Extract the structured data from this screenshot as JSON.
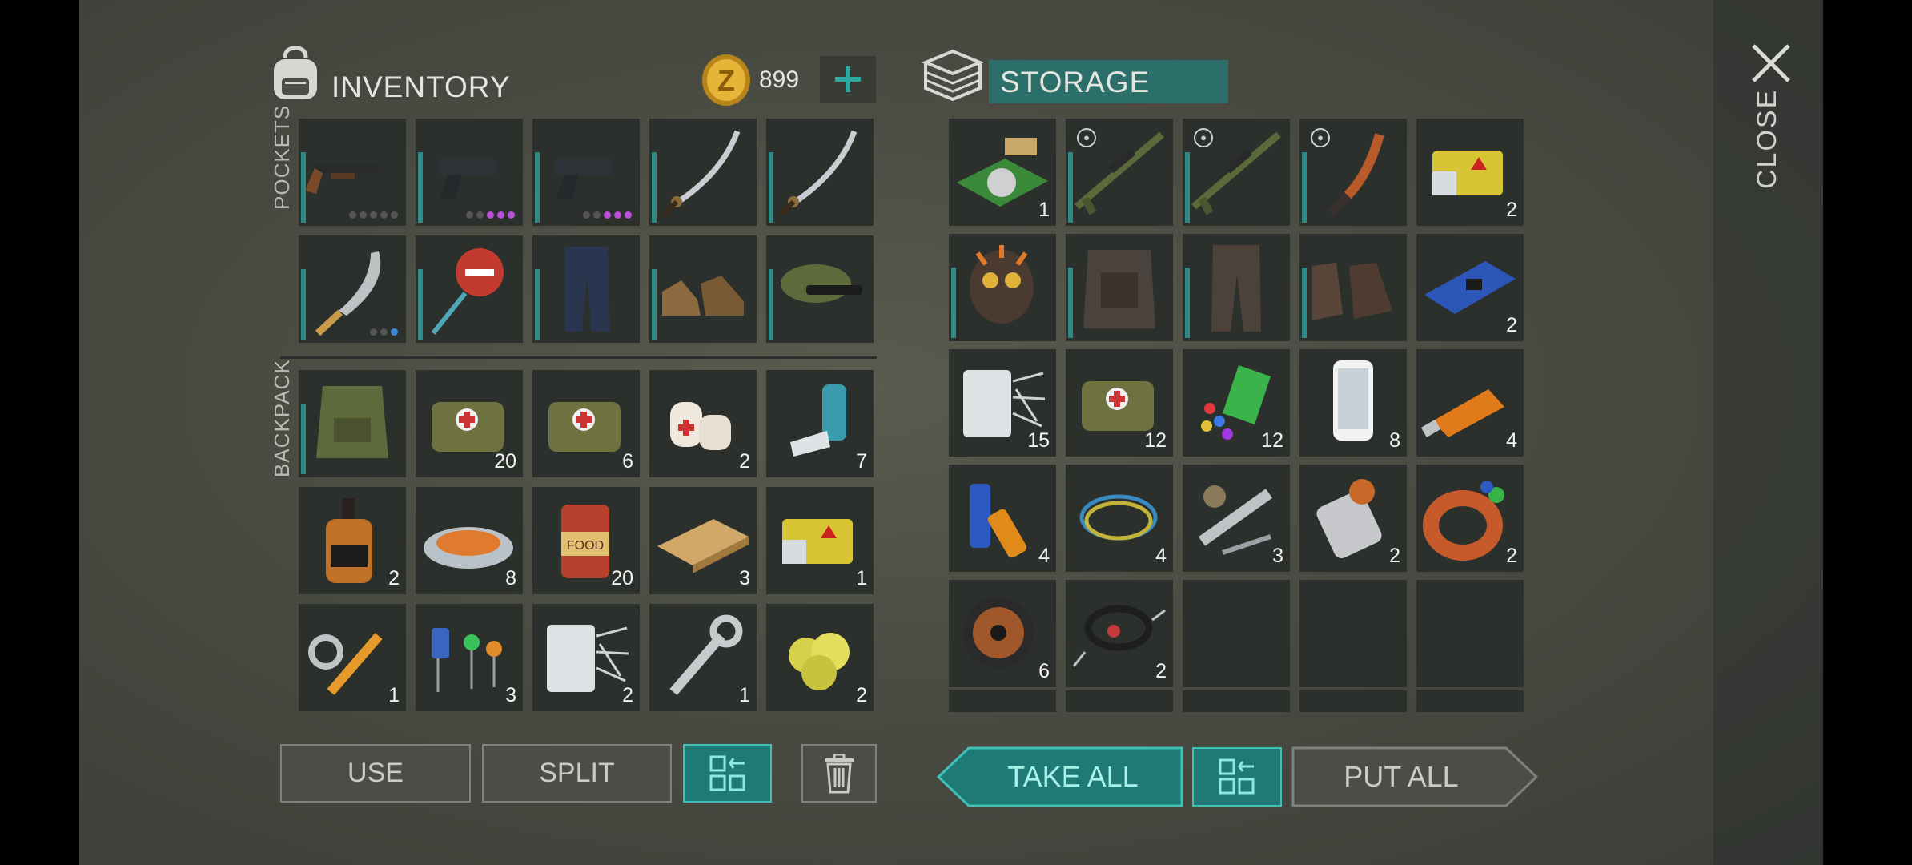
{
  "inventory": {
    "title": "INVENTORY",
    "coins": "899",
    "pockets_label": "POCKETS",
    "backpack_label": "BACKPACK",
    "pockets": [
      {
        "item": "shotgun",
        "dots": [
          "g",
          "g",
          "g",
          "g",
          "g"
        ]
      },
      {
        "item": "pistol",
        "dots": [
          "g",
          "g",
          "p",
          "p",
          "p"
        ]
      },
      {
        "item": "pistol",
        "dots": [
          "g",
          "g",
          "p",
          "p",
          "p"
        ]
      },
      {
        "item": "katana"
      },
      {
        "item": "katana"
      },
      {
        "item": "machete",
        "dots": [
          "g",
          "g",
          "b"
        ]
      },
      {
        "item": "stop-sign"
      },
      {
        "item": "pants"
      },
      {
        "item": "boots"
      },
      {
        "item": "camo-cap"
      }
    ],
    "backpack": [
      {
        "item": "tactical-vest",
        "qty": ""
      },
      {
        "item": "medkit",
        "qty": "20"
      },
      {
        "item": "medkit",
        "qty": "6"
      },
      {
        "item": "bandage",
        "qty": "2"
      },
      {
        "item": "inhaler",
        "qty": "7"
      },
      {
        "item": "whiskey",
        "qty": "2"
      },
      {
        "item": "stew",
        "qty": "8"
      },
      {
        "item": "canned-food",
        "qty": "20"
      },
      {
        "item": "wood-plank",
        "qty": "3"
      },
      {
        "item": "battery-box",
        "qty": "1"
      },
      {
        "item": "hydraulic-parts",
        "qty": "1"
      },
      {
        "item": "electronic-components",
        "qty": "3"
      },
      {
        "item": "fiberglass",
        "qty": "2"
      },
      {
        "item": "wrench",
        "qty": "1"
      },
      {
        "item": "sulfur",
        "qty": "2"
      }
    ],
    "buttons": {
      "use": "USE",
      "split": "SPLIT"
    }
  },
  "storage": {
    "title": "STORAGE",
    "close": "CLOSE",
    "items": [
      {
        "item": "circuit-sensor",
        "qty": "1"
      },
      {
        "item": "sniper-rifle",
        "qty": "",
        "shield": true
      },
      {
        "item": "sniper-rifle",
        "qty": "",
        "shield": true
      },
      {
        "item": "flame-knife",
        "qty": "",
        "shield": true
      },
      {
        "item": "battery-box",
        "qty": "2"
      },
      {
        "item": "gas-mask",
        "qty": ""
      },
      {
        "item": "armor-vest",
        "qty": ""
      },
      {
        "item": "armor-pants",
        "qty": ""
      },
      {
        "item": "armor-boots",
        "qty": ""
      },
      {
        "item": "circuit-board",
        "qty": "2"
      },
      {
        "item": "fiberglass",
        "qty": "15"
      },
      {
        "item": "medkit",
        "qty": "12"
      },
      {
        "item": "crayons",
        "qty": "12"
      },
      {
        "item": "smartphone",
        "qty": "8"
      },
      {
        "item": "usb-drive",
        "qty": "4"
      },
      {
        "item": "batteries",
        "qty": "4"
      },
      {
        "item": "wire-coil",
        "qty": "4"
      },
      {
        "item": "motor-tools",
        "qty": "3"
      },
      {
        "item": "electric-motor",
        "qty": "2"
      },
      {
        "item": "copper-toroid",
        "qty": "2"
      },
      {
        "item": "copper-spool",
        "qty": "6"
      },
      {
        "item": "cables",
        "qty": "2"
      },
      {
        "item": "empty",
        "qty": ""
      },
      {
        "item": "empty",
        "qty": ""
      },
      {
        "item": "empty",
        "qty": ""
      }
    ],
    "buttons": {
      "take_all": "TAKE ALL",
      "put_all": "PUT ALL"
    }
  },
  "colors": {
    "accent": "#1f7a75",
    "accent_light": "#3fc0b8",
    "coin": "#e0a92a"
  }
}
